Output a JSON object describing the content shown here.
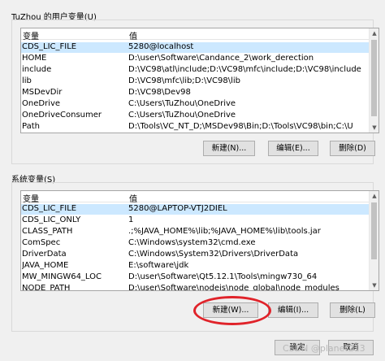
{
  "user_vars": {
    "group_label": "TuZhou 的用户变量(U)",
    "col_name": "变量",
    "col_value": "值",
    "rows": [
      {
        "name": "CDS_LIC_FILE",
        "value": "5280@localhost"
      },
      {
        "name": "HOME",
        "value": "D:\\user\\Software\\Candance_2\\work_derection"
      },
      {
        "name": "include",
        "value": "D:\\VC98\\atl\\include;D:\\VC98\\mfc\\include;D:\\VC98\\include"
      },
      {
        "name": "lib",
        "value": "D:\\VC98\\mfc\\lib;D:\\VC98\\lib"
      },
      {
        "name": "MSDevDir",
        "value": "D:\\VC98\\Dev98"
      },
      {
        "name": "OneDrive",
        "value": "C:\\Users\\TuZhou\\OneDrive"
      },
      {
        "name": "OneDriveConsumer",
        "value": "C:\\Users\\TuZhou\\OneDrive"
      },
      {
        "name": "Path",
        "value": "D:\\Tools\\VC_NT_D;\\MSDev98\\Bin;D:\\Tools\\VC98\\bin;C:\\U"
      }
    ],
    "new_label": "新建(N)...",
    "edit_label": "编辑(E)...",
    "delete_label": "删除(D)"
  },
  "system_vars": {
    "group_label": "系统变量(S)",
    "col_name": "变量",
    "col_value": "值",
    "rows": [
      {
        "name": "CDS_LIC_FILE",
        "value": "5280@LAPTOP-VTJ2DIEL"
      },
      {
        "name": "CDS_LIC_ONLY",
        "value": "1"
      },
      {
        "name": "CLASS_PATH",
        "value": ".;%JAVA_HOME%\\lib;%JAVA_HOME%\\lib\\tools.jar"
      },
      {
        "name": "ComSpec",
        "value": "C:\\Windows\\system32\\cmd.exe"
      },
      {
        "name": "DriverData",
        "value": "C:\\Windows\\System32\\Drivers\\DriverData"
      },
      {
        "name": "JAVA_HOME",
        "value": "E:\\software\\jdk"
      },
      {
        "name": "MW_MINGW64_LOC",
        "value": "D:\\user\\Software\\Qt5.12.1\\Tools\\mingw730_64"
      },
      {
        "name": "NODE_PATH",
        "value": "D:\\user\\Software\\nodejs\\node_global\\node_modules"
      }
    ],
    "new_label": "新建(W)...",
    "edit_label": "编辑(I)...",
    "delete_label": "删除(L)"
  },
  "footer": {
    "ok_label": "确定",
    "cancel_label": "取消"
  },
  "watermark": "CSDN @planet213",
  "accent_selected": "#cce8ff",
  "highlight_color": "#e0232a"
}
